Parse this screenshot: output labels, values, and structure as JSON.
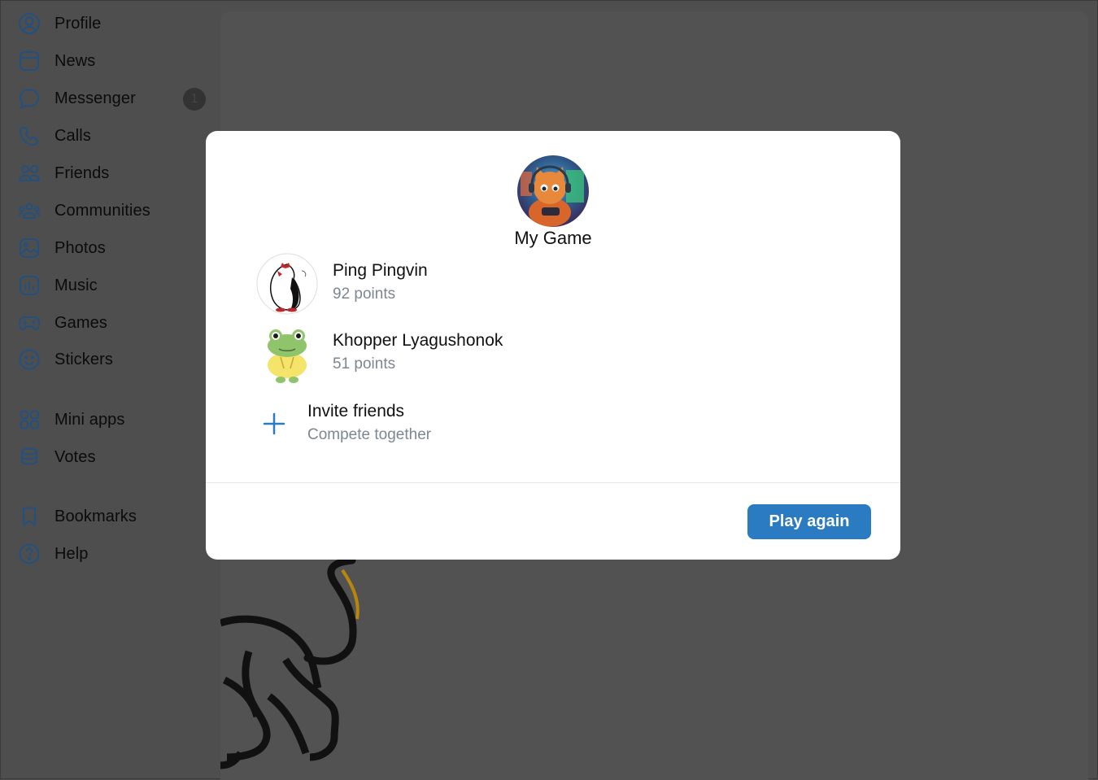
{
  "sidebar": {
    "items": [
      {
        "label": "Profile",
        "icon": "profile-icon"
      },
      {
        "label": "News",
        "icon": "news-icon"
      },
      {
        "label": "Messenger",
        "icon": "messenger-icon",
        "badge": "1"
      },
      {
        "label": "Calls",
        "icon": "phone-icon"
      },
      {
        "label": "Friends",
        "icon": "friends-icon"
      },
      {
        "label": "Communities",
        "icon": "communities-icon"
      },
      {
        "label": "Photos",
        "icon": "photos-icon"
      },
      {
        "label": "Music",
        "icon": "music-icon"
      },
      {
        "label": "Games",
        "icon": "gamepad-icon"
      },
      {
        "label": "Stickers",
        "icon": "smile-icon"
      },
      {
        "label": "Mini apps",
        "icon": "apps-grid-icon"
      },
      {
        "label": "Votes",
        "icon": "votes-icon"
      },
      {
        "label": "Bookmarks",
        "icon": "bookmark-icon"
      },
      {
        "label": "Help",
        "icon": "help-icon"
      }
    ]
  },
  "modal": {
    "game_title": "My Game",
    "players": [
      {
        "name": "Ping Pingvin",
        "points": "92 points"
      },
      {
        "name": "Khopper Lyagushonok",
        "points": "51 points"
      }
    ],
    "invite": {
      "title": "Invite friends",
      "subtitle": "Compete together"
    },
    "play_again_label": "Play again"
  },
  "colors": {
    "accent": "#2b7bc3",
    "icon_blue": "#2a5f9a",
    "overlay": "#4e4e4e"
  }
}
